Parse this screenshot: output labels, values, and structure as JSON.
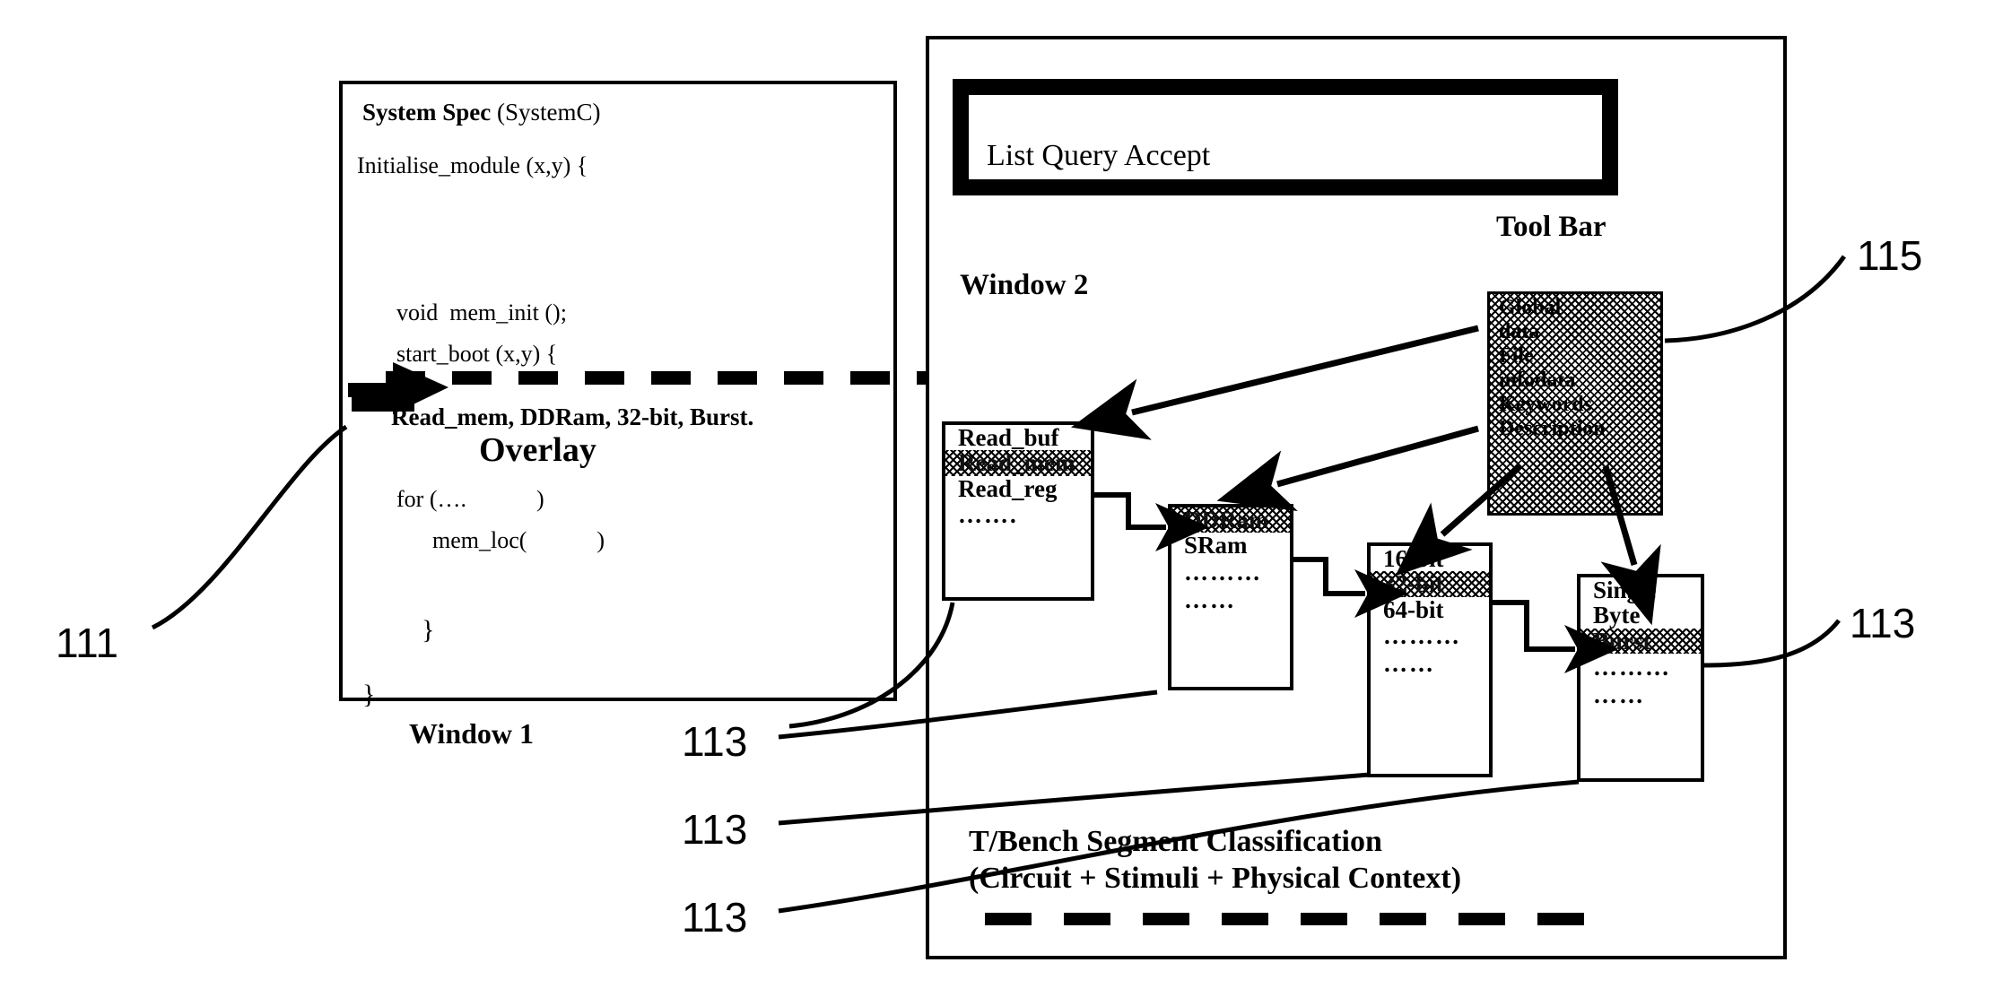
{
  "figure": {
    "window1": {
      "title_bold": "System Spec",
      "title_rest": " (SystemC)",
      "lines": [
        "Initialise_module (x,y) {",
        "void  mem_init ();",
        "start_boot (x,y) {",
        "Read_mem, DDRam, 32-bit, Burst.",
        "for (….            )",
        "mem_loc(            )",
        "}",
        "}"
      ],
      "overlay_label": "Overlay",
      "caption": "Window 1"
    },
    "window2": {
      "toolbar_items": "List Query Accept",
      "toolbar_caption": "Tool Bar",
      "caption": "Window 2",
      "attribute_box": {
        "rows": [
          "Global",
          "data",
          "File",
          "infodata",
          "Keywords",
          "Description"
        ]
      },
      "boxes": [
        {
          "name": "read-operations",
          "rows": [
            {
              "label": "Read_buf",
              "highlighted": false
            },
            {
              "label": "Read_mem",
              "highlighted": true
            },
            {
              "label": "Read_reg",
              "highlighted": false
            }
          ],
          "dots": [
            "……."
          ]
        },
        {
          "name": "memory-type",
          "rows": [
            {
              "label": "DDRam",
              "highlighted": true
            },
            {
              "label": "SRam",
              "highlighted": false
            }
          ],
          "dots": [
            "………",
            "……"
          ]
        },
        {
          "name": "bus-width",
          "rows": [
            {
              "label": "16-bit",
              "highlighted": false
            },
            {
              "label": "32-bit",
              "highlighted": true
            },
            {
              "label": "64-bit",
              "highlighted": false
            }
          ],
          "dots": [
            "………",
            "……"
          ]
        },
        {
          "name": "transfer-mode",
          "rows": [
            {
              "label": "Single",
              "highlighted": false
            },
            {
              "label": "Byte",
              "highlighted": false
            },
            {
              "label": "Burst",
              "highlighted": true
            }
          ],
          "dots": [
            "………",
            "……"
          ]
        }
      ],
      "bottom_caption_line1": "T/Bench Segment Classification",
      "bottom_caption_line2": "(Circuit + Stimuli + Physical Context)"
    },
    "reference_numerals": {
      "n111": "111",
      "n113_a": "113",
      "n113_b": "113",
      "n113_c": "113",
      "n113_right": "113",
      "n115": "115"
    },
    "colors": {
      "ink": "#000000",
      "paper": "#ffffff"
    }
  }
}
